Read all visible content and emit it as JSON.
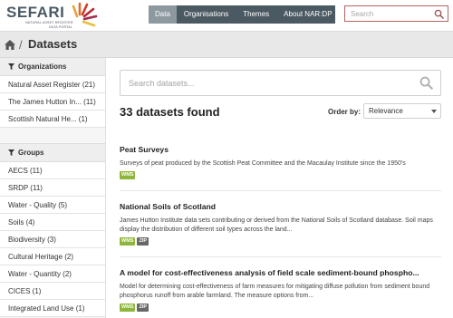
{
  "header": {
    "logo_text": "SEFARI",
    "logo_sub1": "NATURAL ASSET REGISTER",
    "logo_sub2": "DATA PORTAL",
    "nav": [
      {
        "label": "Data",
        "active": true
      },
      {
        "label": "Organisations",
        "active": false
      },
      {
        "label": "Themes",
        "active": false
      },
      {
        "label": "About NAR:DP",
        "active": false
      }
    ],
    "search_placeholder": "Search"
  },
  "breadcrumb": {
    "separator": "/",
    "current": "Datasets"
  },
  "sidebar": {
    "organizations": {
      "heading": "Organizations",
      "items": [
        "Natural Asset Register (21)",
        "The James Hutton In... (11)",
        "Scottish Natural He... (1)"
      ]
    },
    "groups": {
      "heading": "Groups",
      "items": [
        "AECS (11)",
        "SRDP (11)",
        "Water - Quality (5)",
        "Soils (4)",
        "Biodiversity (3)",
        "Cultural Heritage (2)",
        "Water - Quantity (2)",
        "CICES (1)",
        "Integrated Land Use (1)"
      ]
    }
  },
  "main": {
    "search_placeholder": "Search datasets...",
    "count_text": "33 datasets found",
    "order_label": "Order by:",
    "order_value": "Relevance",
    "datasets": [
      {
        "title": "Peat Surveys",
        "description": "Surveys of peat produced by the Scottish Peat Committee and the Macaulay Institute since the 1950's",
        "badges": [
          "WMS"
        ]
      },
      {
        "title": "National Soils of Scotland",
        "description": "James Hutton Institute data sets contributing or derived from the National Soils of Scotland database. Soil maps display the distribution of different soil types across the land...",
        "badges": [
          "WMS",
          "ZIP"
        ]
      },
      {
        "title": "A model for cost-effectiveness analysis of field scale sediment-bound phospho...",
        "description": "Model for determining cost-effectiveness of farm measures for mitigating diffuse pollution from sediment bound phosphorus runoff from arable farmland. The measure options from...",
        "badges": [
          "WMS",
          "ZIP"
        ]
      }
    ]
  },
  "colors": {
    "nav_bg": "#4b5962",
    "nav_active": "#8d989f",
    "search_border": "#b36461",
    "wms_badge": "#8fb63a",
    "zip_badge": "#686868"
  }
}
